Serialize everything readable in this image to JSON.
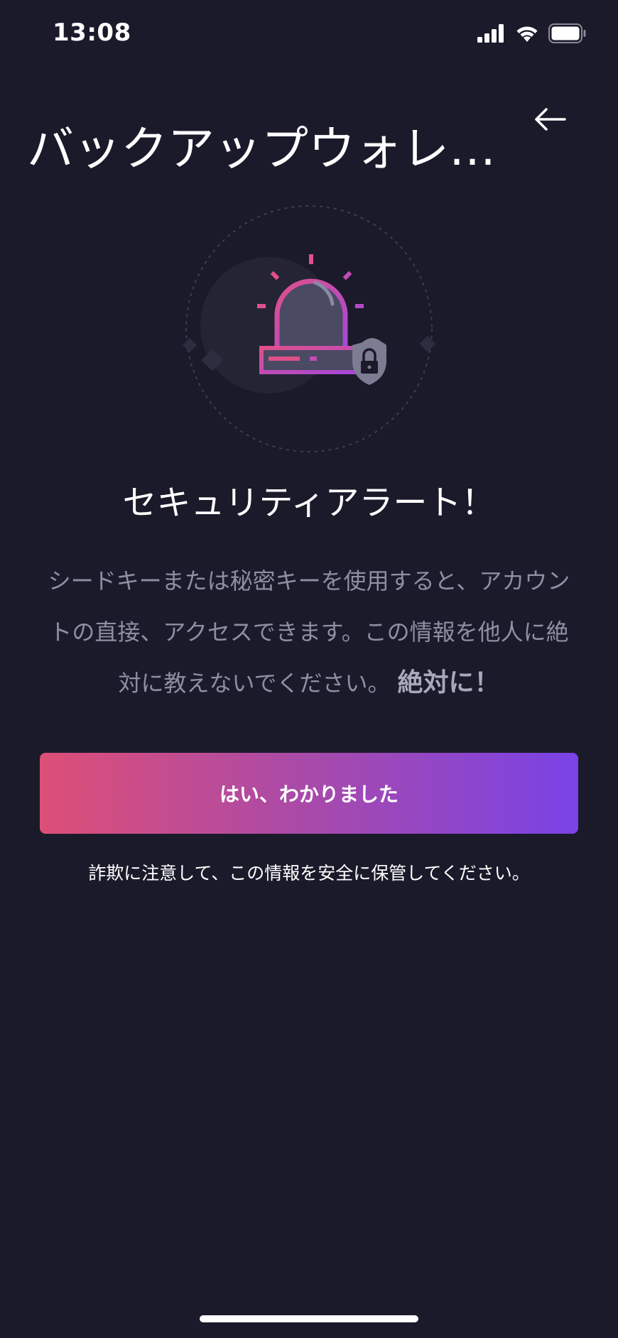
{
  "status_bar": {
    "time": "13:08",
    "icons": [
      "cellular-signal-icon",
      "wifi-icon",
      "battery-icon"
    ]
  },
  "header": {
    "title": "バックアップウォレット",
    "back_icon": "arrow-left-icon"
  },
  "illustration": {
    "icons": [
      "siren-alarm-icon",
      "shield-lock-icon"
    ]
  },
  "alert": {
    "title": "セキュリティアラート！",
    "description": "シードキーまたは秘密キーを使用すると、アカウントの直接、アクセスできます。この情報を他人に絶対に教えないでください。",
    "emphasis": "絶対に！"
  },
  "actions": {
    "confirm_label": "はい、わかりました"
  },
  "footer": {
    "note": "詐欺に注意して、この情報を安全に保管してください。"
  },
  "colors": {
    "background": "#1a1a2a",
    "gradient_start": "#dd4f76",
    "gradient_end": "#7a42e6",
    "muted_text": "#8e8ea4"
  }
}
